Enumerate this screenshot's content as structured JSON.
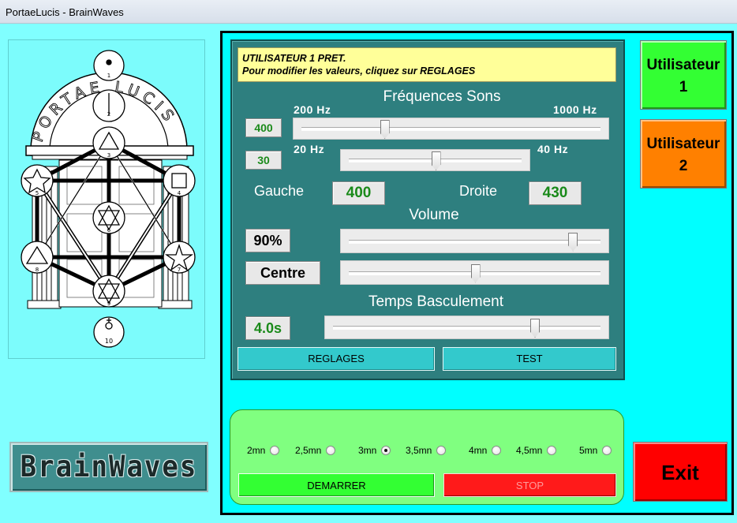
{
  "window": {
    "title": "PortaeLucis - BrainWaves"
  },
  "diagram": {
    "arc_text": "PORTAE LUCIS",
    "node_numbers": [
      "1",
      "2",
      "3",
      "4",
      "5",
      "6",
      "7",
      "8",
      "9",
      "10"
    ]
  },
  "logo": {
    "text": "BrainWaves"
  },
  "status": {
    "line1": "UTILISATEUR 1 PRET.",
    "line2": "Pour modifier les valeurs, cliquez sur REGLAGES"
  },
  "frequencies": {
    "title": "Fréquences Sons",
    "carrier": {
      "value": "400",
      "min_label": "200 Hz",
      "max_label": "1000 Hz",
      "level": 0.27
    },
    "beat": {
      "value": "30",
      "min_label": "20 Hz",
      "max_label": "40 Hz",
      "level": 0.5
    },
    "left_label": "Gauche",
    "left_value": "400",
    "right_label": "Droite",
    "right_value": "430"
  },
  "volume": {
    "title": "Volume",
    "value": "90%",
    "level": 0.9,
    "balance_value": "Centre",
    "balance_level": 0.5
  },
  "switch_time": {
    "title": "Temps Basculement",
    "value": "4.0s",
    "level": 0.76
  },
  "buttons": {
    "settings": "REGLAGES",
    "test": "TEST",
    "start": "DEMARRER",
    "stop": "STOP",
    "exit": "Exit"
  },
  "users": {
    "user1": {
      "line1": "Utilisateur",
      "line2": "1",
      "color": "#33ff33"
    },
    "user2": {
      "line1": "Utilisateur",
      "line2": "2",
      "color": "#ff8000"
    }
  },
  "duration": {
    "options": [
      "2mn",
      "2,5mn",
      "3mn",
      "3,5mn",
      "4mn",
      "4,5mn",
      "5mn"
    ],
    "selected": "3mn"
  },
  "colors": {
    "background": "#80ffff",
    "panel": "#2e7f7f",
    "status_bg": "#ffff99",
    "value_text": "#1a8a1a"
  }
}
